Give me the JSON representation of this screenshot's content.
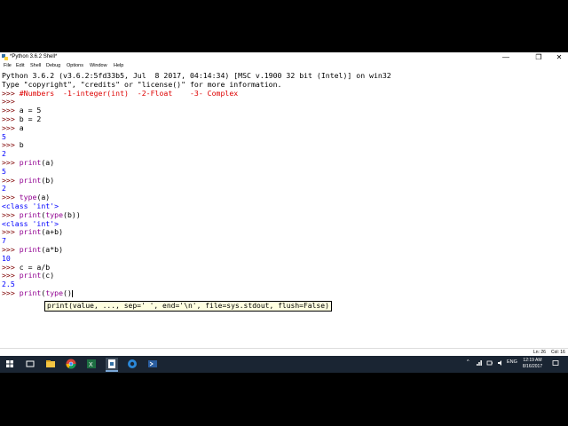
{
  "window": {
    "title": "*Python 3.6.2 Shell*",
    "minimize": "—",
    "maximize": "❐",
    "close": "✕"
  },
  "menu": [
    "File",
    "Edit",
    "Shell",
    "Debug",
    "Options",
    "Window",
    "Help"
  ],
  "shell_lines": [
    [
      {
        "t": "Python 3.6.2 (v3.6.2:5fd33b5, Jul  8 2017, 04:14:34) [MSC v.1900 32 bit (Intel)] on win32",
        "c": "plain"
      }
    ],
    [
      {
        "t": "Type \"copyright\", \"credits\" or \"license()\" for more information.",
        "c": "plain"
      }
    ],
    [
      {
        "t": ">>> ",
        "c": "prompt"
      },
      {
        "t": "#Numbers  -1-integer(int)  -2-Float    -3- Complex",
        "c": "comment"
      }
    ],
    [
      {
        "t": ">>>",
        "c": "prompt"
      }
    ],
    [
      {
        "t": ">>> ",
        "c": "prompt"
      },
      {
        "t": "a = 5",
        "c": "plain"
      }
    ],
    [
      {
        "t": ">>> ",
        "c": "prompt"
      },
      {
        "t": "b = 2",
        "c": "plain"
      }
    ],
    [
      {
        "t": ">>> ",
        "c": "prompt"
      },
      {
        "t": "a",
        "c": "plain"
      }
    ],
    [
      {
        "t": "5",
        "c": "out"
      }
    ],
    [
      {
        "t": ">>> ",
        "c": "prompt"
      },
      {
        "t": "b",
        "c": "plain"
      }
    ],
    [
      {
        "t": "2",
        "c": "out"
      }
    ],
    [
      {
        "t": ">>> ",
        "c": "prompt"
      },
      {
        "t": "print",
        "c": "builtin"
      },
      {
        "t": "(a)",
        "c": "plain"
      }
    ],
    [
      {
        "t": "5",
        "c": "out"
      }
    ],
    [
      {
        "t": ">>> ",
        "c": "prompt"
      },
      {
        "t": "print",
        "c": "builtin"
      },
      {
        "t": "(b)",
        "c": "plain"
      }
    ],
    [
      {
        "t": "2",
        "c": "out"
      }
    ],
    [
      {
        "t": ">>> ",
        "c": "prompt"
      },
      {
        "t": "type",
        "c": "builtin"
      },
      {
        "t": "(a)",
        "c": "plain"
      }
    ],
    [
      {
        "t": "<class 'int'>",
        "c": "out"
      }
    ],
    [
      {
        "t": ">>> ",
        "c": "prompt"
      },
      {
        "t": "print",
        "c": "builtin"
      },
      {
        "t": "(",
        "c": "plain"
      },
      {
        "t": "type",
        "c": "builtin"
      },
      {
        "t": "(b))",
        "c": "plain"
      }
    ],
    [
      {
        "t": "<class 'int'>",
        "c": "out"
      }
    ],
    [
      {
        "t": ">>> ",
        "c": "prompt"
      },
      {
        "t": "print",
        "c": "builtin"
      },
      {
        "t": "(a+b)",
        "c": "plain"
      }
    ],
    [
      {
        "t": "7",
        "c": "out"
      }
    ],
    [
      {
        "t": ">>> ",
        "c": "prompt"
      },
      {
        "t": "print",
        "c": "builtin"
      },
      {
        "t": "(a*b)",
        "c": "plain"
      }
    ],
    [
      {
        "t": "10",
        "c": "out"
      }
    ],
    [
      {
        "t": ">>> ",
        "c": "prompt"
      },
      {
        "t": "c = a/b",
        "c": "plain"
      }
    ],
    [
      {
        "t": ">>> ",
        "c": "prompt"
      },
      {
        "t": "print",
        "c": "builtin"
      },
      {
        "t": "(c)",
        "c": "plain"
      }
    ],
    [
      {
        "t": "2.5",
        "c": "out"
      }
    ],
    [
      {
        "t": ">>> ",
        "c": "prompt"
      },
      {
        "t": "print",
        "c": "builtin"
      },
      {
        "t": "(",
        "c": "plain"
      },
      {
        "t": "type",
        "c": "builtin"
      },
      {
        "t": "()",
        "c": "plain"
      },
      {
        "t": "",
        "c": "cursor"
      }
    ]
  ],
  "calltip": "print(value, ..., sep=' ', end='\\n', file=sys.stdout, flush=False)",
  "status": {
    "line": "Ln: 26",
    "col": "Col: 16"
  },
  "taskbar": {
    "apps": [
      "start-icon",
      "search-icon",
      "task-view-icon",
      "file-explorer-icon",
      "chrome-icon",
      "excel-icon",
      "idle-icon",
      "edge-icon",
      "powershell-icon"
    ],
    "tray_up": "^",
    "lang": "ENG",
    "time": "12:19 AM",
    "date": "8/16/2017"
  },
  "colors": {
    "output": "#0000ff",
    "prompt": "#7f0000",
    "builtin": "#900090",
    "comment": "#dd0000",
    "taskbar": "#1a2533"
  }
}
